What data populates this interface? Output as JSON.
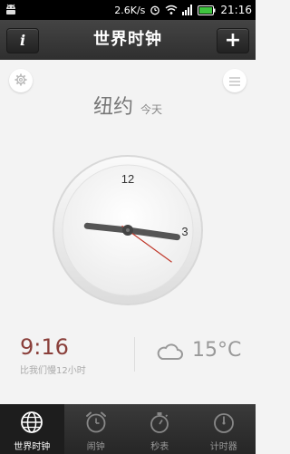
{
  "status_bar": {
    "net_speed": "2.6K/s",
    "time": "21:16"
  },
  "header": {
    "title": "世界时钟",
    "info_label": "i",
    "add_label": "+"
  },
  "city": {
    "name": "纽约",
    "day": "今天"
  },
  "clock": {
    "hour": 3,
    "minute": 16,
    "second": 21,
    "label_12": "12",
    "label_3": "3"
  },
  "local": {
    "time": "9:16",
    "difference": "比我们慢12小时"
  },
  "weather": {
    "icon": "cloud-icon",
    "temperature": "15°C"
  },
  "nav": [
    {
      "label": "世界时钟",
      "icon": "globe-icon",
      "active": true
    },
    {
      "label": "闹钟",
      "icon": "alarm-clock-icon",
      "active": false
    },
    {
      "label": "秒表",
      "icon": "stopwatch-icon",
      "active": false
    },
    {
      "label": "计时器",
      "icon": "timer-icon",
      "active": false
    }
  ],
  "colors": {
    "accent": "#8a3f3a",
    "second_hand": "#c0392b"
  }
}
